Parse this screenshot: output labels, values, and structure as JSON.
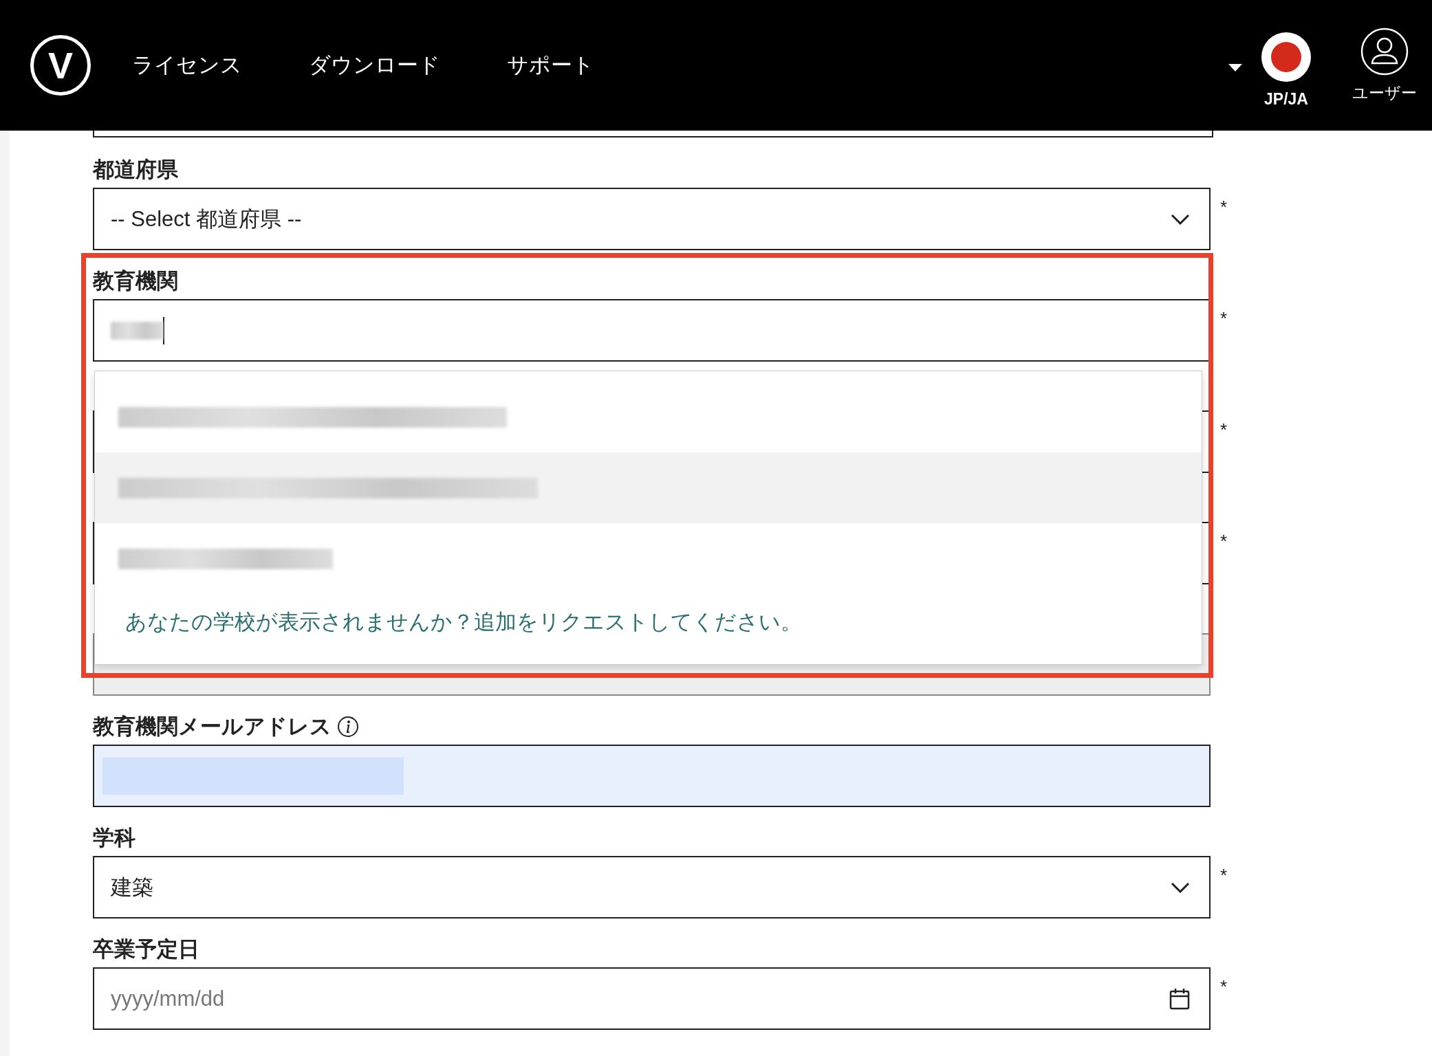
{
  "header": {
    "logo": {
      "mark": "V"
    },
    "nav": [
      {
        "label": "ライセンス"
      },
      {
        "label": "ダウンロード"
      },
      {
        "label": "サポート"
      }
    ],
    "language": {
      "label": "JP/JA"
    },
    "user": {
      "label": "ユーザー"
    }
  },
  "form": {
    "fields": [
      {
        "kind": "partial"
      },
      {
        "kind": "select",
        "label": "都道府県",
        "value": "-- Select 都道府県 --",
        "required_mark": "*"
      },
      {
        "kind": "autocomplete",
        "label": "教育機関",
        "required_mark": "*",
        "highlighted": true,
        "suggestions": [
          {
            "selected": false
          },
          {
            "selected": true
          },
          {
            "selected": false
          }
        ],
        "footer_link": "あなたの学校が表示されませんか？追加をリクエストしてください。"
      },
      {
        "kind": "covered",
        "required_mark": "*"
      },
      {
        "kind": "covered",
        "required_mark": "*"
      },
      {
        "kind": "covered",
        "disabled": true
      },
      {
        "kind": "email",
        "label": "教育機関メールアドレス",
        "autofilled": true
      },
      {
        "kind": "select",
        "label": "学科",
        "value": "建築",
        "required_mark": "*"
      },
      {
        "kind": "date",
        "label": "卒業予定日",
        "placeholder": "yyyy/mm/dd",
        "required_mark": "*"
      }
    ]
  }
}
